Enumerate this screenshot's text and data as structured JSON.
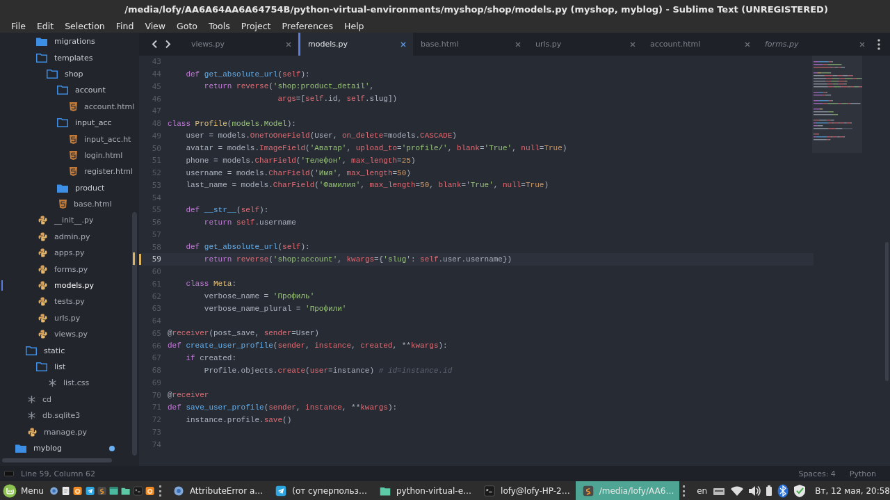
{
  "window": {
    "title": "/media/lofy/AA6A64AA6A64754B/python-virtual-environments/myshop/shop/models.py (myshop, myblog) - Sublime Text (UNREGISTERED)"
  },
  "menu": [
    "File",
    "Edit",
    "Selection",
    "Find",
    "View",
    "Goto",
    "Tools",
    "Project",
    "Preferences",
    "Help"
  ],
  "sidebar": {
    "items": [
      {
        "children": [
          {
            "children": [
              {
                "name": "migrations",
                "kind": "folder",
                "expanded": false
              },
              {
                "name": "templates",
                "kind": "folder",
                "expanded": true,
                "children": [
                  {
                    "name": "shop",
                    "kind": "folder",
                    "expanded": true,
                    "children": [
                      {
                        "name": "account",
                        "kind": "folder",
                        "expanded": true,
                        "children": [
                          {
                            "name": "account.html",
                            "kind": "html",
                            "selected": false
                          }
                        ]
                      },
                      {
                        "name": "input_acc",
                        "kind": "folder",
                        "expanded": true,
                        "children": [
                          {
                            "name": "input_acc.ht",
                            "kind": "html",
                            "selected": false
                          },
                          {
                            "name": "login.html",
                            "kind": "html",
                            "selected": false
                          },
                          {
                            "name": "register.html",
                            "kind": "html",
                            "selected": false
                          }
                        ]
                      },
                      {
                        "name": "product",
                        "kind": "folder",
                        "expanded": false
                      },
                      {
                        "name": "base.html",
                        "kind": "html",
                        "selected": false
                      }
                    ]
                  }
                ]
              },
              {
                "name": "__init__.py",
                "kind": "python",
                "selected": false
              },
              {
                "name": "admin.py",
                "kind": "python",
                "selected": false
              },
              {
                "name": "apps.py",
                "kind": "python",
                "selected": false
              },
              {
                "name": "forms.py",
                "kind": "python",
                "selected": false
              },
              {
                "name": "models.py",
                "kind": "python",
                "selected": true
              },
              {
                "name": "tests.py",
                "kind": "python",
                "selected": false
              },
              {
                "name": "urls.py",
                "kind": "python",
                "selected": false
              },
              {
                "name": "views.py",
                "kind": "python",
                "selected": false
              }
            ]
          },
          {
            "name": "static",
            "kind": "folder",
            "expanded": true,
            "children": [
              {
                "name": "list",
                "kind": "folder",
                "expanded": true,
                "children": [
                  {
                    "name": "list.css",
                    "kind": "file",
                    "selected": false
                  }
                ]
              }
            ]
          },
          {
            "name": "cd",
            "kind": "file",
            "selected": false
          },
          {
            "name": "db.sqlite3",
            "kind": "file",
            "selected": false
          },
          {
            "name": "manage.py",
            "kind": "python",
            "selected": false
          }
        ]
      },
      {
        "name": "myblog",
        "kind": "folder",
        "expanded": false,
        "modified": true
      }
    ]
  },
  "tabs": [
    {
      "label": "views.py",
      "selected": false,
      "preview": false
    },
    {
      "label": "models.py",
      "selected": true,
      "preview": false
    },
    {
      "label": "base.html",
      "selected": false,
      "preview": false
    },
    {
      "label": "urls.py",
      "selected": false,
      "preview": false
    },
    {
      "label": "account.html",
      "selected": false,
      "preview": false
    },
    {
      "label": "forms.py",
      "selected": false,
      "preview": true
    }
  ],
  "editor": {
    "lines": [
      {
        "number": "43",
        "current": false
      },
      {
        "number": "44",
        "current": false,
        "tokens": [
          {
            "kind": "keyword",
            "text": "    def "
          },
          {
            "kind": "function",
            "text": "get_absolute_url"
          },
          {
            "kind": "plain",
            "text": "("
          },
          {
            "kind": "name",
            "text": "self"
          },
          {
            "kind": "plain",
            "text": "):"
          }
        ]
      },
      {
        "number": "45",
        "current": false,
        "tokens": [
          {
            "kind": "keyword",
            "text": "        return "
          },
          {
            "kind": "name",
            "text": "reverse"
          },
          {
            "kind": "plain",
            "text": "("
          },
          {
            "kind": "string",
            "text": "'shop:product_detail'"
          },
          {
            "kind": "plain",
            "text": ","
          }
        ]
      },
      {
        "number": "46",
        "current": false,
        "tokens": [
          {
            "kind": "name",
            "text": "                        args"
          },
          {
            "kind": "plain",
            "text": "=["
          },
          {
            "kind": "name",
            "text": "self"
          },
          {
            "kind": "plain",
            "text": ".id, "
          },
          {
            "kind": "name",
            "text": "self"
          },
          {
            "kind": "plain",
            "text": ".slug])"
          }
        ]
      },
      {
        "number": "47",
        "current": false
      },
      {
        "number": "48",
        "current": false,
        "tokens": [
          {
            "kind": "keyword",
            "text": "class "
          },
          {
            "kind": "class",
            "text": "Profile"
          },
          {
            "kind": "plain",
            "text": "("
          },
          {
            "kind": "base",
            "text": "models.Model"
          },
          {
            "kind": "plain",
            "text": "):"
          }
        ]
      },
      {
        "number": "49",
        "current": false,
        "tokens": [
          {
            "kind": "plain",
            "text": "    user = models."
          },
          {
            "kind": "name",
            "text": "OneToOneField"
          },
          {
            "kind": "plain",
            "text": "(User, "
          },
          {
            "kind": "name",
            "text": "on_delete"
          },
          {
            "kind": "plain",
            "text": "=models."
          },
          {
            "kind": "name",
            "text": "CASCADE"
          },
          {
            "kind": "plain",
            "text": ")"
          }
        ]
      },
      {
        "number": "50",
        "current": false,
        "tokens": [
          {
            "kind": "plain",
            "text": "    avatar = models."
          },
          {
            "kind": "name",
            "text": "ImageField"
          },
          {
            "kind": "plain",
            "text": "("
          },
          {
            "kind": "string",
            "text": "'Аватар'"
          },
          {
            "kind": "plain",
            "text": ", "
          },
          {
            "kind": "name",
            "text": "upload_to"
          },
          {
            "kind": "plain",
            "text": "="
          },
          {
            "kind": "string",
            "text": "'profile/'"
          },
          {
            "kind": "plain",
            "text": ", "
          },
          {
            "kind": "name",
            "text": "blank"
          },
          {
            "kind": "plain",
            "text": "="
          },
          {
            "kind": "string",
            "text": "'True'"
          },
          {
            "kind": "plain",
            "text": ", "
          },
          {
            "kind": "name",
            "text": "null"
          },
          {
            "kind": "plain",
            "text": "="
          },
          {
            "kind": "number",
            "text": "True"
          },
          {
            "kind": "plain",
            "text": ")"
          }
        ]
      },
      {
        "number": "51",
        "current": false,
        "tokens": [
          {
            "kind": "plain",
            "text": "    phone = models."
          },
          {
            "kind": "name",
            "text": "CharField"
          },
          {
            "kind": "plain",
            "text": "("
          },
          {
            "kind": "string",
            "text": "'Телефон'"
          },
          {
            "kind": "plain",
            "text": ", "
          },
          {
            "kind": "name",
            "text": "max_length"
          },
          {
            "kind": "plain",
            "text": "="
          },
          {
            "kind": "number",
            "text": "25"
          },
          {
            "kind": "plain",
            "text": ")"
          }
        ]
      },
      {
        "number": "52",
        "current": false,
        "tokens": [
          {
            "kind": "plain",
            "text": "    username = models."
          },
          {
            "kind": "name",
            "text": "CharField"
          },
          {
            "kind": "plain",
            "text": "("
          },
          {
            "kind": "string",
            "text": "'Имя'"
          },
          {
            "kind": "plain",
            "text": ", "
          },
          {
            "kind": "name",
            "text": "max_length"
          },
          {
            "kind": "plain",
            "text": "="
          },
          {
            "kind": "number",
            "text": "50"
          },
          {
            "kind": "plain",
            "text": ")"
          }
        ]
      },
      {
        "number": "53",
        "current": false,
        "tokens": [
          {
            "kind": "plain",
            "text": "    last_name = models."
          },
          {
            "kind": "name",
            "text": "CharField"
          },
          {
            "kind": "plain",
            "text": "("
          },
          {
            "kind": "string",
            "text": "'Фамилия'"
          },
          {
            "kind": "plain",
            "text": ", "
          },
          {
            "kind": "name",
            "text": "max_length"
          },
          {
            "kind": "plain",
            "text": "="
          },
          {
            "kind": "number",
            "text": "50"
          },
          {
            "kind": "plain",
            "text": ", "
          },
          {
            "kind": "name",
            "text": "blank"
          },
          {
            "kind": "plain",
            "text": "="
          },
          {
            "kind": "string",
            "text": "'True'"
          },
          {
            "kind": "plain",
            "text": ", "
          },
          {
            "kind": "name",
            "text": "null"
          },
          {
            "kind": "plain",
            "text": "="
          },
          {
            "kind": "number",
            "text": "True"
          },
          {
            "kind": "plain",
            "text": ")"
          }
        ]
      },
      {
        "number": "54",
        "current": false
      },
      {
        "number": "55",
        "current": false,
        "tokens": [
          {
            "kind": "keyword",
            "text": "    def "
          },
          {
            "kind": "function",
            "text": "__str__"
          },
          {
            "kind": "plain",
            "text": "("
          },
          {
            "kind": "name",
            "text": "self"
          },
          {
            "kind": "plain",
            "text": "):"
          }
        ]
      },
      {
        "number": "56",
        "current": false,
        "tokens": [
          {
            "kind": "keyword",
            "text": "        return "
          },
          {
            "kind": "name",
            "text": "self"
          },
          {
            "kind": "plain",
            "text": ".username"
          }
        ]
      },
      {
        "number": "57",
        "current": false
      },
      {
        "number": "58",
        "current": false,
        "tokens": [
          {
            "kind": "keyword",
            "text": "    def "
          },
          {
            "kind": "function",
            "text": "get_absolute_url"
          },
          {
            "kind": "plain",
            "text": "("
          },
          {
            "kind": "name",
            "text": "self"
          },
          {
            "kind": "plain",
            "text": "):"
          }
        ]
      },
      {
        "number": "59",
        "current": true,
        "tokens": [
          {
            "kind": "keyword",
            "text": "        return "
          },
          {
            "kind": "name",
            "text": "reverse"
          },
          {
            "kind": "plain",
            "text": "("
          },
          {
            "kind": "string",
            "text": "'shop:account'"
          },
          {
            "kind": "plain",
            "text": ", "
          },
          {
            "kind": "name",
            "text": "kwargs"
          },
          {
            "kind": "plain",
            "text": "={"
          },
          {
            "kind": "string",
            "text": "'slug'"
          },
          {
            "kind": "plain",
            "text": ": "
          },
          {
            "kind": "name",
            "text": "self"
          },
          {
            "kind": "plain",
            "text": ".user.username})"
          }
        ]
      },
      {
        "number": "60",
        "current": false
      },
      {
        "number": "61",
        "current": false,
        "tokens": [
          {
            "kind": "keyword",
            "text": "    class "
          },
          {
            "kind": "class",
            "text": "Meta"
          },
          {
            "kind": "plain",
            "text": ":"
          }
        ]
      },
      {
        "number": "62",
        "current": false,
        "tokens": [
          {
            "kind": "plain",
            "text": "        verbose_name = "
          },
          {
            "kind": "string",
            "text": "'Профиль'"
          }
        ]
      },
      {
        "number": "63",
        "current": false,
        "tokens": [
          {
            "kind": "plain",
            "text": "        verbose_name_plural = "
          },
          {
            "kind": "string",
            "text": "'Профили'"
          }
        ]
      },
      {
        "number": "64",
        "current": false
      },
      {
        "number": "65",
        "current": false,
        "tokens": [
          {
            "kind": "plain",
            "text": "@"
          },
          {
            "kind": "name",
            "text": "receiver"
          },
          {
            "kind": "plain",
            "text": "(post_save, "
          },
          {
            "kind": "name",
            "text": "sender"
          },
          {
            "kind": "plain",
            "text": "=User)"
          }
        ]
      },
      {
        "number": "66",
        "current": false,
        "tokens": [
          {
            "kind": "keyword",
            "text": "def "
          },
          {
            "kind": "function",
            "text": "create_user_profile"
          },
          {
            "kind": "plain",
            "text": "("
          },
          {
            "kind": "name",
            "text": "sender"
          },
          {
            "kind": "plain",
            "text": ", "
          },
          {
            "kind": "name",
            "text": "instance"
          },
          {
            "kind": "plain",
            "text": ", "
          },
          {
            "kind": "name",
            "text": "created"
          },
          {
            "kind": "plain",
            "text": ", **"
          },
          {
            "kind": "name",
            "text": "kwargs"
          },
          {
            "kind": "plain",
            "text": "):"
          }
        ]
      },
      {
        "number": "67",
        "current": false,
        "tokens": [
          {
            "kind": "keyword",
            "text": "    if"
          },
          {
            "kind": "plain",
            "text": " created:"
          }
        ]
      },
      {
        "number": "68",
        "current": false,
        "tokens": [
          {
            "kind": "plain",
            "text": "        Profile.objects."
          },
          {
            "kind": "name",
            "text": "create"
          },
          {
            "kind": "plain",
            "text": "("
          },
          {
            "kind": "name",
            "text": "user"
          },
          {
            "kind": "plain",
            "text": "=instance) "
          },
          {
            "kind": "comment",
            "text": "# id=instance.id"
          }
        ]
      },
      {
        "number": "69",
        "current": false
      },
      {
        "number": "70",
        "current": false,
        "tokens": [
          {
            "kind": "plain",
            "text": "@"
          },
          {
            "kind": "name",
            "text": "receiver"
          }
        ]
      },
      {
        "number": "71",
        "current": false,
        "tokens": [
          {
            "kind": "keyword",
            "text": "def "
          },
          {
            "kind": "function",
            "text": "save_user_profile"
          },
          {
            "kind": "plain",
            "text": "("
          },
          {
            "kind": "name",
            "text": "sender"
          },
          {
            "kind": "plain",
            "text": ", "
          },
          {
            "kind": "name",
            "text": "instance"
          },
          {
            "kind": "plain",
            "text": ", **"
          },
          {
            "kind": "name",
            "text": "kwargs"
          },
          {
            "kind": "plain",
            "text": "):"
          }
        ]
      },
      {
        "number": "72",
        "current": false,
        "tokens": [
          {
            "kind": "plain",
            "text": "    instance.profile."
          },
          {
            "kind": "name",
            "text": "save"
          },
          {
            "kind": "plain",
            "text": "()"
          }
        ]
      },
      {
        "number": "73",
        "current": false
      },
      {
        "number": "74",
        "current": false
      }
    ]
  },
  "status_bar": {
    "position": "Line 59, Column 62",
    "indentation": "Spaces: 4",
    "syntax": "Python"
  },
  "taskbar": {
    "menu": "Menu",
    "launchers": [
      {
        "kind": "browser"
      },
      {
        "kind": "document"
      },
      {
        "kind": "fox"
      },
      {
        "kind": "plane"
      },
      {
        "kind": "editor"
      },
      {
        "kind": "window"
      },
      {
        "kind": "folder"
      },
      {
        "kind": "terminal"
      },
      {
        "kind": "fox"
      }
    ],
    "windows": [
      {
        "kind": "browser",
        "title": "AttributeError a…",
        "selected": false
      },
      {
        "kind": "plane",
        "title": "(от суперпольз…",
        "selected": false
      },
      {
        "kind": "folder",
        "title": "python-virtual-e…",
        "selected": false
      },
      {
        "kind": "terminal",
        "title": "lofy@lofy-HP-2…",
        "selected": false
      },
      {
        "kind": "editor",
        "title": "/media/lofy/AA6…",
        "selected": true
      }
    ],
    "keyboard_layout": "en",
    "clock": "Вт, 12 мая, 20:58"
  }
}
